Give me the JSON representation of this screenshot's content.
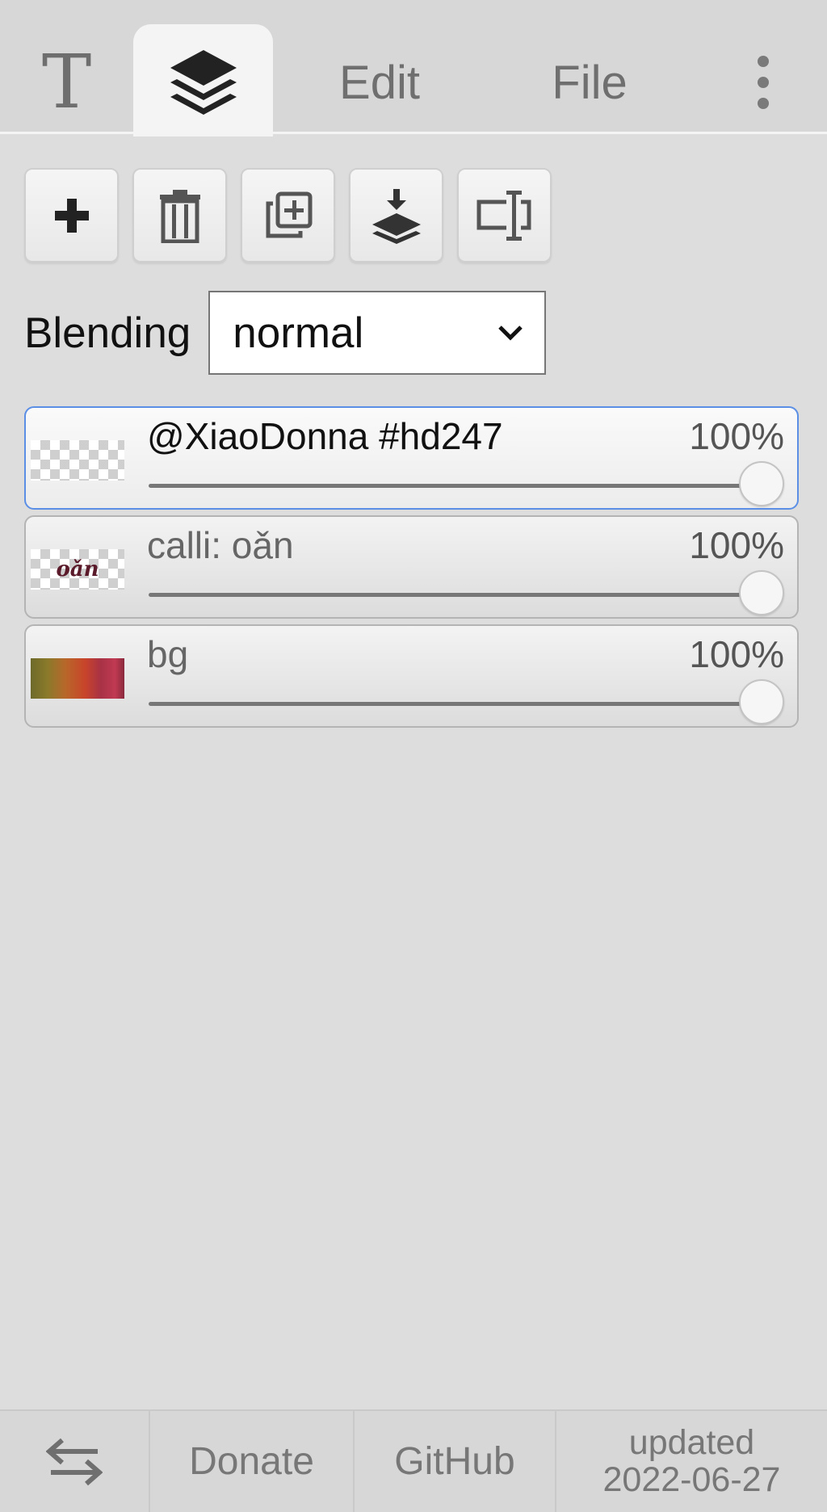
{
  "tabs": {
    "text_glyph": "T",
    "layers_icon": "layers-icon",
    "edit_label": "Edit",
    "file_label": "File",
    "more_icon": "more-vertical-icon"
  },
  "toolbar": {
    "buttons": [
      {
        "name": "add-layer",
        "icon": "plus-icon"
      },
      {
        "name": "delete-layer",
        "icon": "trash-icon"
      },
      {
        "name": "duplicate-layer",
        "icon": "duplicate-icon"
      },
      {
        "name": "merge-down",
        "icon": "merge-down-icon"
      },
      {
        "name": "rename-layer",
        "icon": "rename-icon"
      }
    ]
  },
  "blending": {
    "label": "Blending",
    "value": "normal"
  },
  "layers": [
    {
      "name": "@XiaoDonna #hd247",
      "opacity": "100%",
      "opacity_value": 100,
      "active": true,
      "thumb": "transparent"
    },
    {
      "name": "calli: oǎn",
      "opacity": "100%",
      "opacity_value": 100,
      "active": false,
      "thumb": "calligraphy",
      "thumb_text": "oǎn"
    },
    {
      "name": "bg",
      "opacity": "100%",
      "opacity_value": 100,
      "active": false,
      "thumb": "background"
    }
  ],
  "footer": {
    "swap_icon": "swap-arrows-icon",
    "donate_label": "Donate",
    "github_label": "GitHub",
    "updated_label": "updated",
    "updated_date": "2022-06-27"
  },
  "colors": {
    "background": "#dddddd",
    "active_border": "#5b8fe6",
    "tab_active": "#f4f4f4"
  }
}
